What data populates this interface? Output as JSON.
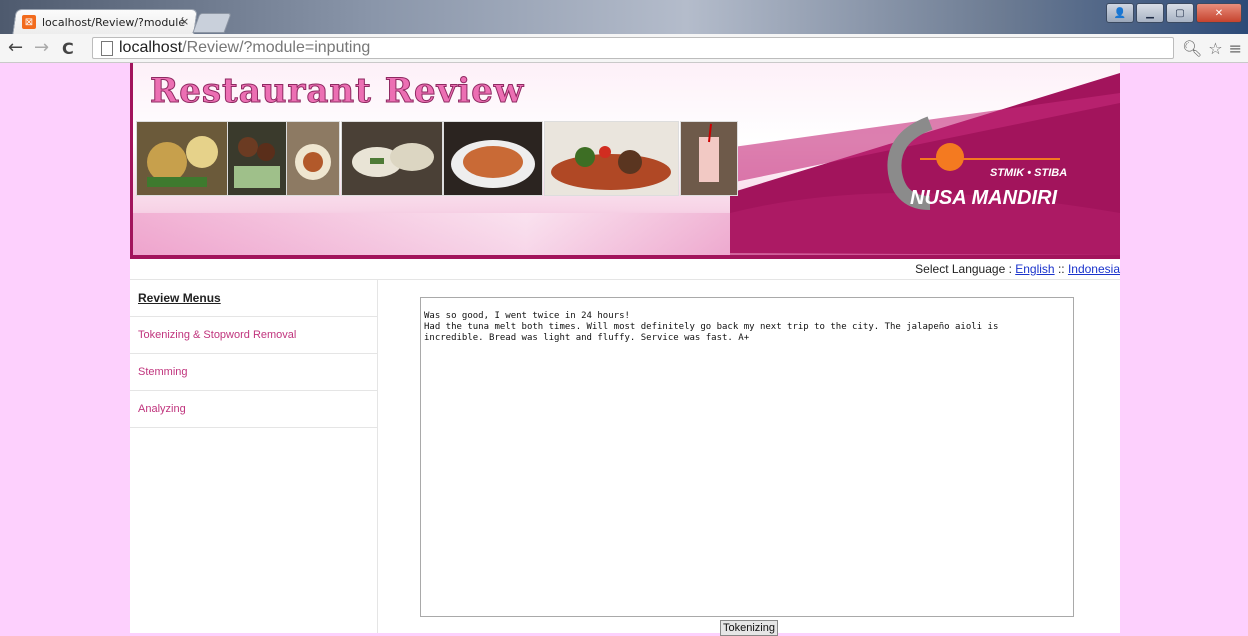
{
  "browser": {
    "tab_title": "localhost/Review/?modulé",
    "tab_close": "×",
    "url_host": "localhost",
    "url_path": "/Review/?module=inputing",
    "back": "←",
    "forward": "→",
    "reload": "C",
    "icons": [
      "page-icon",
      "zoom-icon",
      "star-icon",
      "menu-icon"
    ]
  },
  "header": {
    "title": "Restaurant Review",
    "logo_line1": "STMIK • STIBA",
    "logo_line2": "NUSA MANDIRI"
  },
  "language": {
    "prefix": "Select Language : ",
    "english": "English",
    "separator": " :: ",
    "indonesia": "Indonesia"
  },
  "sidebar": {
    "title": "Review Menus",
    "items": [
      {
        "label": "Tokenizing & Stopword Removal"
      },
      {
        "label": "Stemming"
      },
      {
        "label": "Analyzing"
      }
    ]
  },
  "form": {
    "text_line1": "Was so good, I went twice in 24 hours!",
    "text_line2": "",
    "text_line3": "Had the tuna melt both times. Will most definitely go back my next trip to the city. The jalapeño aioli is",
    "text_line4": "incredible. Bread was light and fluffy. Service was fast. A+",
    "submit_label": "Tokenizing"
  },
  "colors": {
    "page_bg": "#fdd0fd",
    "accent": "#a2145c",
    "menu_link": "#c0347d",
    "lang_link": "#1a33cc"
  }
}
